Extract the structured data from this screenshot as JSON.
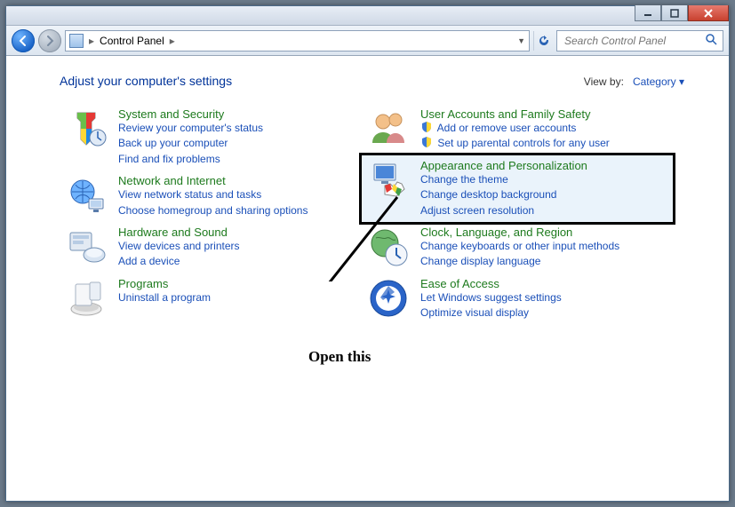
{
  "breadcrumb": {
    "root": "Control Panel"
  },
  "search": {
    "placeholder": "Search Control Panel"
  },
  "header": {
    "title": "Adjust your computer's settings",
    "viewby_label": "View by:",
    "viewby_value": "Category"
  },
  "categories": {
    "left": [
      {
        "id": "system-security",
        "title": "System and Security",
        "links": [
          "Review your computer's status",
          "Back up your computer",
          "Find and fix problems"
        ]
      },
      {
        "id": "network-internet",
        "title": "Network and Internet",
        "links": [
          "View network status and tasks",
          "Choose homegroup and sharing options"
        ]
      },
      {
        "id": "hardware-sound",
        "title": "Hardware and Sound",
        "links": [
          "View devices and printers",
          "Add a device"
        ]
      },
      {
        "id": "programs",
        "title": "Programs",
        "links": [
          "Uninstall a program"
        ]
      }
    ],
    "right": [
      {
        "id": "user-accounts",
        "title": "User Accounts and Family Safety",
        "links": [
          "Add or remove user accounts",
          "Set up parental controls for any user"
        ],
        "mini_icons": [
          "shield-icon",
          "shield-icon"
        ]
      },
      {
        "id": "appearance",
        "title": "Appearance and Personalization",
        "highlight": true,
        "links": [
          "Change the theme",
          "Change desktop background",
          "Adjust screen resolution"
        ]
      },
      {
        "id": "clock-region",
        "title": "Clock, Language, and Region",
        "links": [
          "Change keyboards or other input methods",
          "Change display language"
        ]
      },
      {
        "id": "ease-access",
        "title": "Ease of Access",
        "links": [
          "Let Windows suggest settings",
          "Optimize visual display"
        ]
      }
    ]
  },
  "annotation": {
    "text": "Open this"
  }
}
